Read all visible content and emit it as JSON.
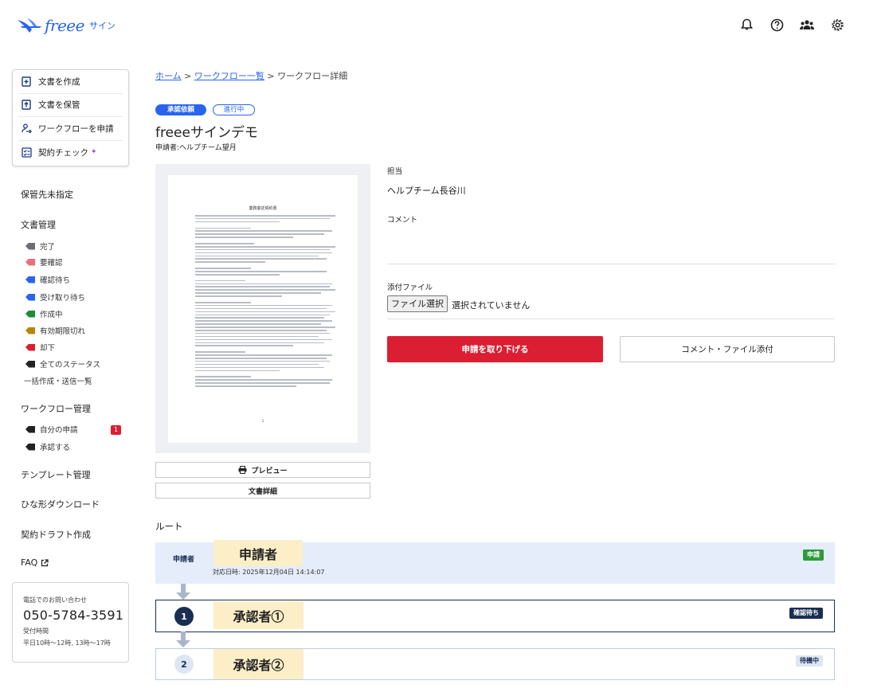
{
  "header": {
    "logo_text": "freee",
    "logo_sub": "サイン",
    "icons": [
      "bell-icon",
      "help-icon",
      "team-icon",
      "gear-icon"
    ]
  },
  "sidebar": {
    "card_items": [
      {
        "label": "文書を作成",
        "icon": "doc-plus-icon"
      },
      {
        "label": "文書を保管",
        "icon": "doc-upload-icon"
      },
      {
        "label": "ワークフローを申請",
        "icon": "user-flow-icon"
      },
      {
        "label": "契約チェック",
        "icon": "check-list-icon"
      }
    ],
    "unassigned": "保管先未指定",
    "doc_mgmt": "文書管理",
    "doc_statuses": [
      {
        "label": "完了",
        "color": "#6b6e75"
      },
      {
        "label": "要確認",
        "color": "#e8707a"
      },
      {
        "label": "確認待ち",
        "color": "#2864f0"
      },
      {
        "label": "受け取り待ち",
        "color": "#2864f0"
      },
      {
        "label": "作成中",
        "color": "#1e8a3c"
      },
      {
        "label": "有効期限切れ",
        "color": "#b8860b"
      },
      {
        "label": "却下",
        "color": "#dc1e32"
      },
      {
        "label": "全てのステータス",
        "color": "#222222"
      }
    ],
    "bulk": "一括作成・送信一覧",
    "workflow_mgmt": "ワークフロー管理",
    "workflow_items": [
      {
        "label": "自分の申請",
        "color": "#222222"
      },
      {
        "label": "承認する",
        "color": "#222222"
      }
    ],
    "my_requests_count": "1",
    "template_mgmt": "テンプレート管理",
    "template_download": "ひな形ダウンロード",
    "contract_draft": "契約ドラフト作成",
    "faq": "FAQ",
    "contact": {
      "label": "電話でのお問い合わせ",
      "phone": "050-5784-3591",
      "hours_label": "受付時間",
      "hours": "平日10時〜12時, 13時〜17時"
    }
  },
  "breadcrumb": {
    "home": "ホーム",
    "sep": ">",
    "workflow_list": "ワークフロー一覧",
    "current": "ワークフロー詳細"
  },
  "badges": {
    "approval": "承認依頼",
    "progress": "進行中"
  },
  "document": {
    "title": "freeeサインデモ",
    "applicant": "申請者:ヘルプチーム望月",
    "page_title": "業務委託契約書",
    "page_number": "1"
  },
  "buttons": {
    "preview": "プレビュー",
    "details": "文書詳細",
    "withdraw": "申請を取り下げる",
    "comment_attach": "コメント・ファイル添付",
    "file_select": "ファイル選択"
  },
  "right": {
    "assignee_label": "担当",
    "assignee": "ヘルプチーム長谷川",
    "comment_label": "コメント",
    "attachment_label": "添付ファイル",
    "no_file": "選択されていません"
  },
  "route": {
    "title": "ルート",
    "applicant_label": "申請者",
    "applicant_stamp": "申請者",
    "applicant_date": "対応日時: 2025年12月04日 14:14:07",
    "applicant_status": "申請",
    "approver1_no": "1",
    "approver1_stamp": "承認者①",
    "approver1_status": "確認待ち",
    "approver2_no": "2",
    "approver2_stamp": "承認者②",
    "approver2_status": "待機中",
    "colors": {
      "applied": "#2d9b3a",
      "waiting_confirm": "#1a2e52",
      "pending_bg": "#dde6f3"
    }
  }
}
